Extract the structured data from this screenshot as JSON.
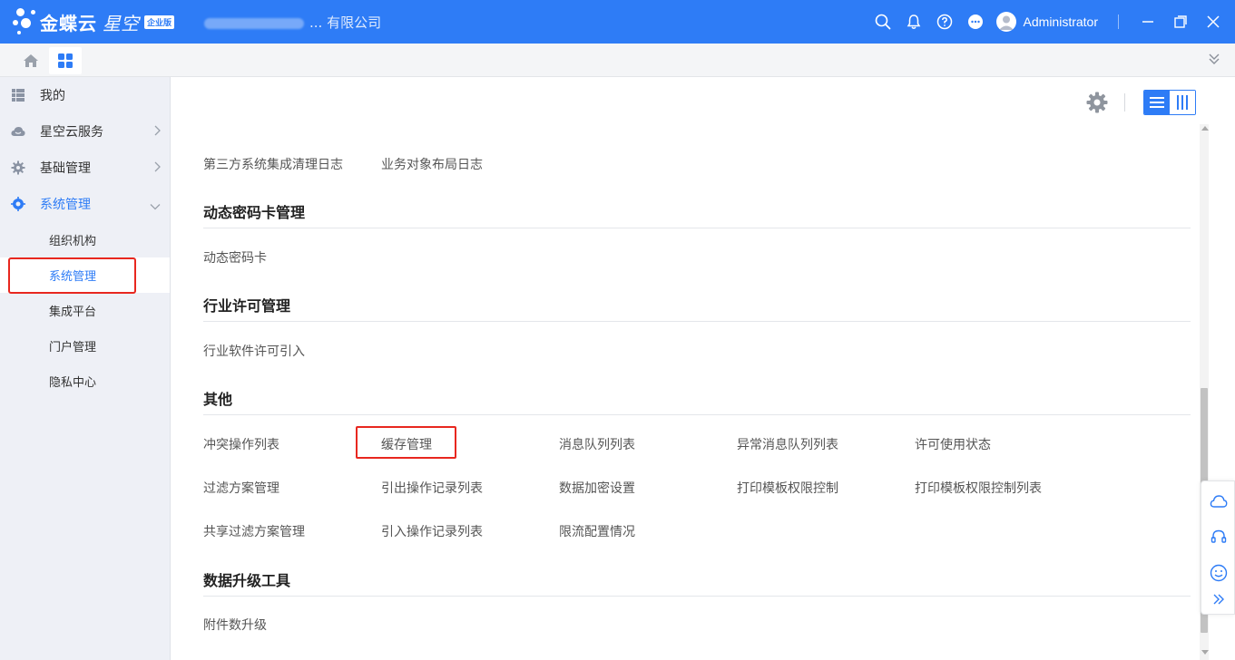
{
  "colors": {
    "brand": "#2e7cf6",
    "highlight": "#e8271f"
  },
  "header": {
    "logo_text": "金蝶云",
    "logo_text2": "星空",
    "logo_badge": "企业版",
    "company_visible": "... 有限公司",
    "user_name": "Administrator",
    "icons": [
      "search-icon",
      "bell-icon",
      "help-icon",
      "more-icon",
      "avatar",
      "minimize-icon",
      "restore-icon",
      "close-icon"
    ]
  },
  "sidebar": {
    "items": [
      {
        "label": "我的",
        "icon": "list-icon"
      },
      {
        "label": "星空云服务",
        "icon": "cloud-icon"
      },
      {
        "label": "基础管理",
        "icon": "gear-icon"
      },
      {
        "label": "系统管理",
        "icon": "target-icon"
      }
    ],
    "sub_items": [
      {
        "label": "组织机构"
      },
      {
        "label": "系统管理"
      },
      {
        "label": "集成平台"
      },
      {
        "label": "门户管理"
      },
      {
        "label": "隐私中心"
      }
    ]
  },
  "main": {
    "top_links": [
      "第三方系统集成清理日志",
      "业务对象布局日志"
    ],
    "sections": [
      {
        "title": "动态密码卡管理",
        "links": [
          "动态密码卡"
        ]
      },
      {
        "title": "行业许可管理",
        "links": [
          "行业软件许可引入"
        ]
      },
      {
        "title": "其他",
        "links": [
          "冲突操作列表",
          "缓存管理",
          "消息队列列表",
          "异常消息队列列表",
          "许可使用状态",
          "过滤方案管理",
          "引出操作记录列表",
          "数据加密设置",
          "打印模板权限控制",
          "打印模板权限控制列表",
          "共享过滤方案管理",
          "引入操作记录列表",
          "限流配置情况"
        ]
      },
      {
        "title": "数据升级工具",
        "links": [
          "附件数升级"
        ]
      }
    ]
  }
}
